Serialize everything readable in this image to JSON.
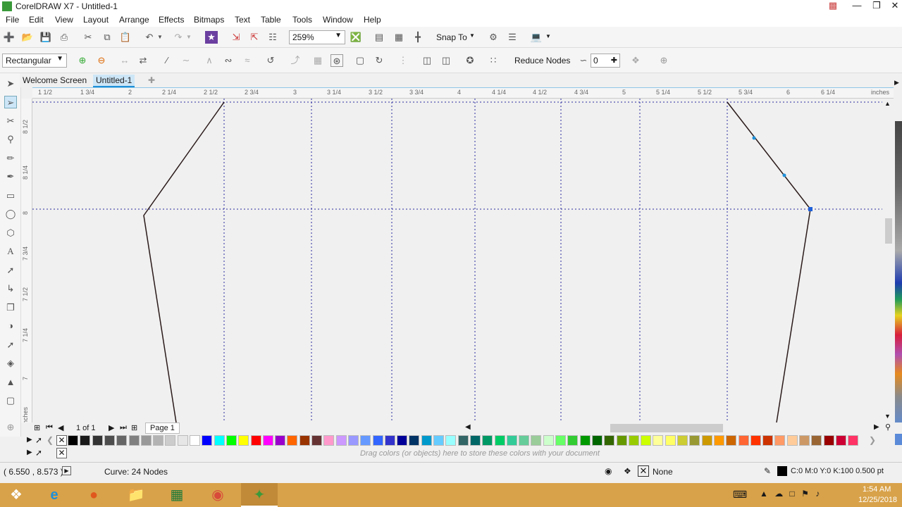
{
  "window": {
    "title": "CorelDRAW X7 - Untitled-1"
  },
  "menu": [
    "File",
    "Edit",
    "View",
    "Layout",
    "Arrange",
    "Effects",
    "Bitmaps",
    "Text",
    "Table",
    "Tools",
    "Window",
    "Help"
  ],
  "toolbar": {
    "zoom": "259%",
    "snap_to": "Snap To"
  },
  "property_bar": {
    "shape_mode": "Rectangular",
    "reduce_nodes": "Reduce Nodes",
    "curve_smoothness": "0"
  },
  "tabs": [
    {
      "label": "Welcome Screen"
    },
    {
      "label": "Untitled-1"
    }
  ],
  "ruler": {
    "h_labels": [
      "1 1/2",
      "1 3/4",
      "2",
      "2 1/4",
      "2 1/2",
      "2 3/4",
      "3",
      "3 1/4",
      "3 1/2",
      "3 3/4",
      "4",
      "4 1/4",
      "4 1/2",
      "4 3/4",
      "5",
      "5 1/4",
      "5 1/2",
      "5 3/4",
      "6",
      "6 1/4",
      "inches"
    ],
    "v_labels": [
      "8 1/2",
      "8 1/4",
      "8",
      "7 3/4",
      "7 1/2",
      "7 1/4",
      "7",
      "inches"
    ]
  },
  "page_nav": {
    "page_count": "1 of 1",
    "page_tab": "Page 1"
  },
  "palette_hint": "Drag colors (or objects) here to store these colors with your document",
  "palette_colors": [
    "#000000",
    "#1a1a1a",
    "#333333",
    "#4d4d4d",
    "#666666",
    "#808080",
    "#999999",
    "#b3b3b3",
    "#cccccc",
    "#e6e6e6",
    "#ffffff",
    "#0000ff",
    "#00ffff",
    "#00ff00",
    "#ffff00",
    "#ff0000",
    "#ff00ff",
    "#9900cc",
    "#ff6600",
    "#993300",
    "#663333",
    "#ff99cc",
    "#cc99ff",
    "#9999ff",
    "#6699ff",
    "#3366ff",
    "#3333cc",
    "#000099",
    "#003366",
    "#0099cc",
    "#66ccff",
    "#99ffff",
    "#336666",
    "#006666",
    "#009966",
    "#00cc66",
    "#33cc99",
    "#66cc99",
    "#99cc99",
    "#ccffcc",
    "#66ff66",
    "#33cc33",
    "#009900",
    "#006600",
    "#336600",
    "#669900",
    "#99cc00",
    "#ccff00",
    "#ffff99",
    "#ffff66",
    "#cccc33",
    "#999933",
    "#cc9900",
    "#ff9900",
    "#cc6600",
    "#ff6633",
    "#ff3300",
    "#cc3300",
    "#ff9966",
    "#ffcc99",
    "#cc9966",
    "#996633",
    "#990000",
    "#cc0033",
    "#ff3366"
  ],
  "status": {
    "coords": "( 6.550 , 8.573 )",
    "object_info": "Curve: 24 Nodes",
    "fill": "None",
    "outline": "C:0 M:0 Y:0 K:100  0.500 pt"
  },
  "taskbar": {
    "time": "1:54 AM",
    "date": "12/25/2018"
  },
  "colors": {
    "accent": "#1e8fd8",
    "taskbar": "#d8a24a",
    "guide": "#2a2aa0",
    "path": "#2b1a1a"
  },
  "icons": [
    "corel-app-icon",
    "new-icon",
    "open-icon",
    "save-icon",
    "print-icon",
    "cut-icon",
    "copy-icon",
    "paste-icon",
    "undo-icon",
    "redo-icon",
    "zoom-icon",
    "pick-tool-icon",
    "shape-tool-icon",
    "windows-start-icon",
    "ie-icon",
    "firefox-icon",
    "file-explorer-icon",
    "excel-icon",
    "chrome-icon",
    "coreldraw-icon"
  ]
}
